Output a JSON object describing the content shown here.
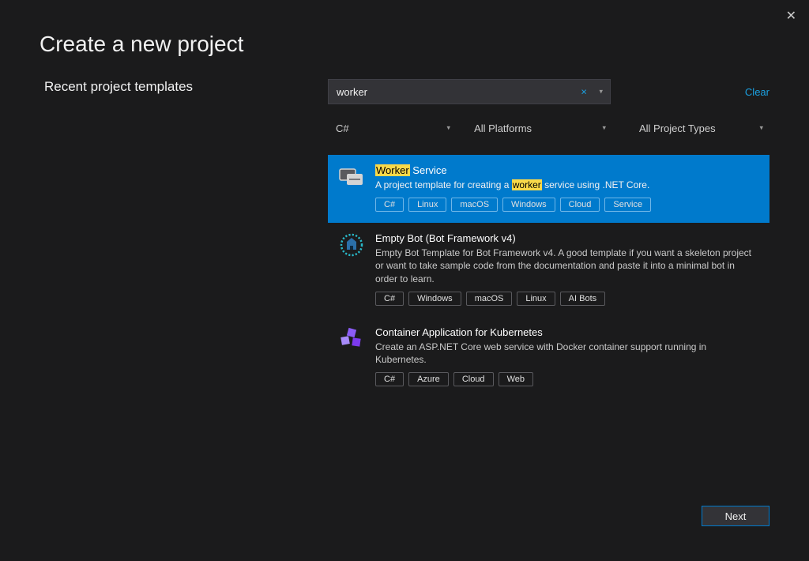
{
  "page_title": "Create a new project",
  "recent_title": "Recent project templates",
  "search": {
    "value": "worker",
    "clear_x": "×",
    "chevron": "▾"
  },
  "clear_link": "Clear",
  "filters": {
    "language": "C#",
    "platform": "All Platforms",
    "project_type": "All Project Types",
    "chevron": "▾"
  },
  "templates": [
    {
      "title_pre_hl": "",
      "title_hl": "Worker",
      "title_post_hl": " Service",
      "desc_pre_hl": "A project template for creating a ",
      "desc_hl": "worker",
      "desc_post_hl": " service using .NET Core.",
      "tags": [
        "C#",
        "Linux",
        "macOS",
        "Windows",
        "Cloud",
        "Service"
      ]
    },
    {
      "title": "Empty Bot (Bot Framework v4)",
      "desc": "Empty Bot Template for Bot Framework v4.  A good template if you want a skeleton project or want to take sample code from the documentation and paste it into a minimal bot in order to learn.",
      "tags": [
        "C#",
        "Windows",
        "macOS",
        "Linux",
        "AI Bots"
      ]
    },
    {
      "title": "Container Application for Kubernetes",
      "desc": "Create an ASP.NET Core web service with Docker container support running in Kubernetes.",
      "tags": [
        "C#",
        "Azure",
        "Cloud",
        "Web"
      ]
    }
  ],
  "next_button": "Next"
}
